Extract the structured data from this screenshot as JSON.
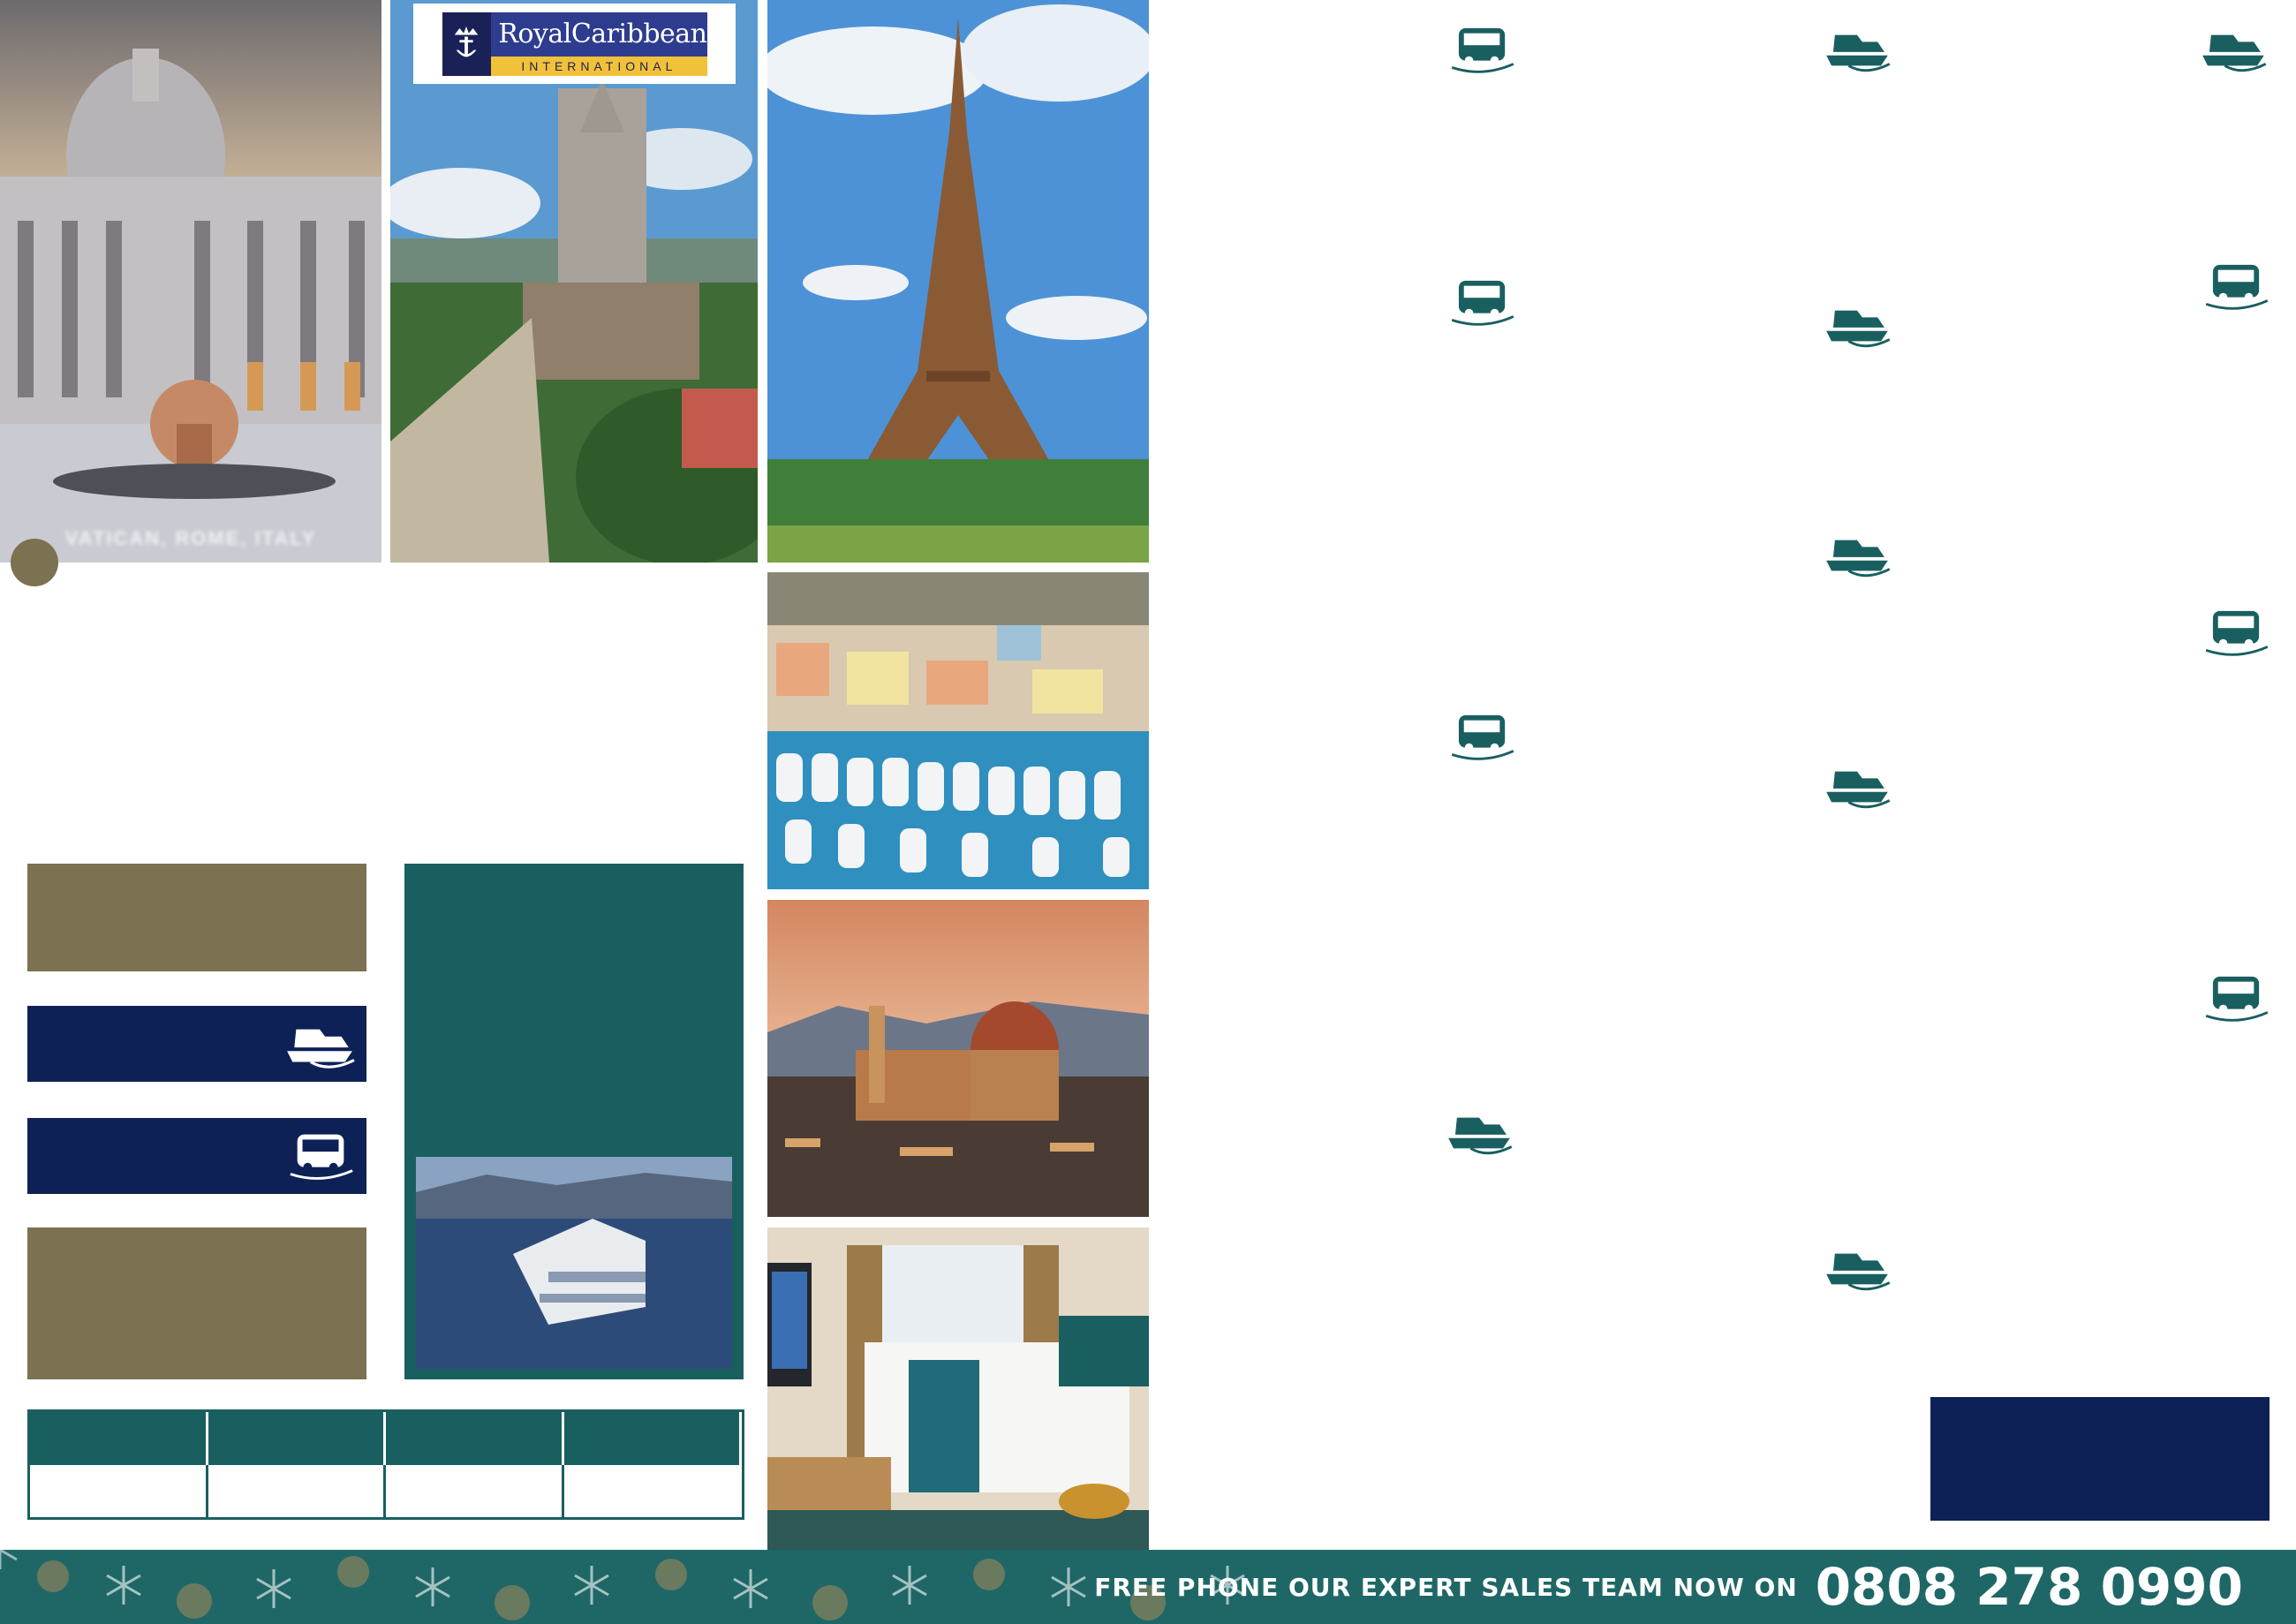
{
  "brand": {
    "name": "RoyalCaribbean",
    "subtitle": "INTERNATIONAL"
  },
  "photos": {
    "vatican_caption": "VATICAN, ROME, ITALY"
  },
  "footer": {
    "cta_text": "FREE PHONE OUR EXPERT SALES TEAM NOW ON",
    "phone": "0808 278 0990"
  },
  "colors": {
    "olive": "#7c7150",
    "navy": "#0d2156",
    "teal": "#1a5f60",
    "footer": "#1f6767"
  },
  "icons": [
    "ship-icon",
    "coach-icon"
  ]
}
